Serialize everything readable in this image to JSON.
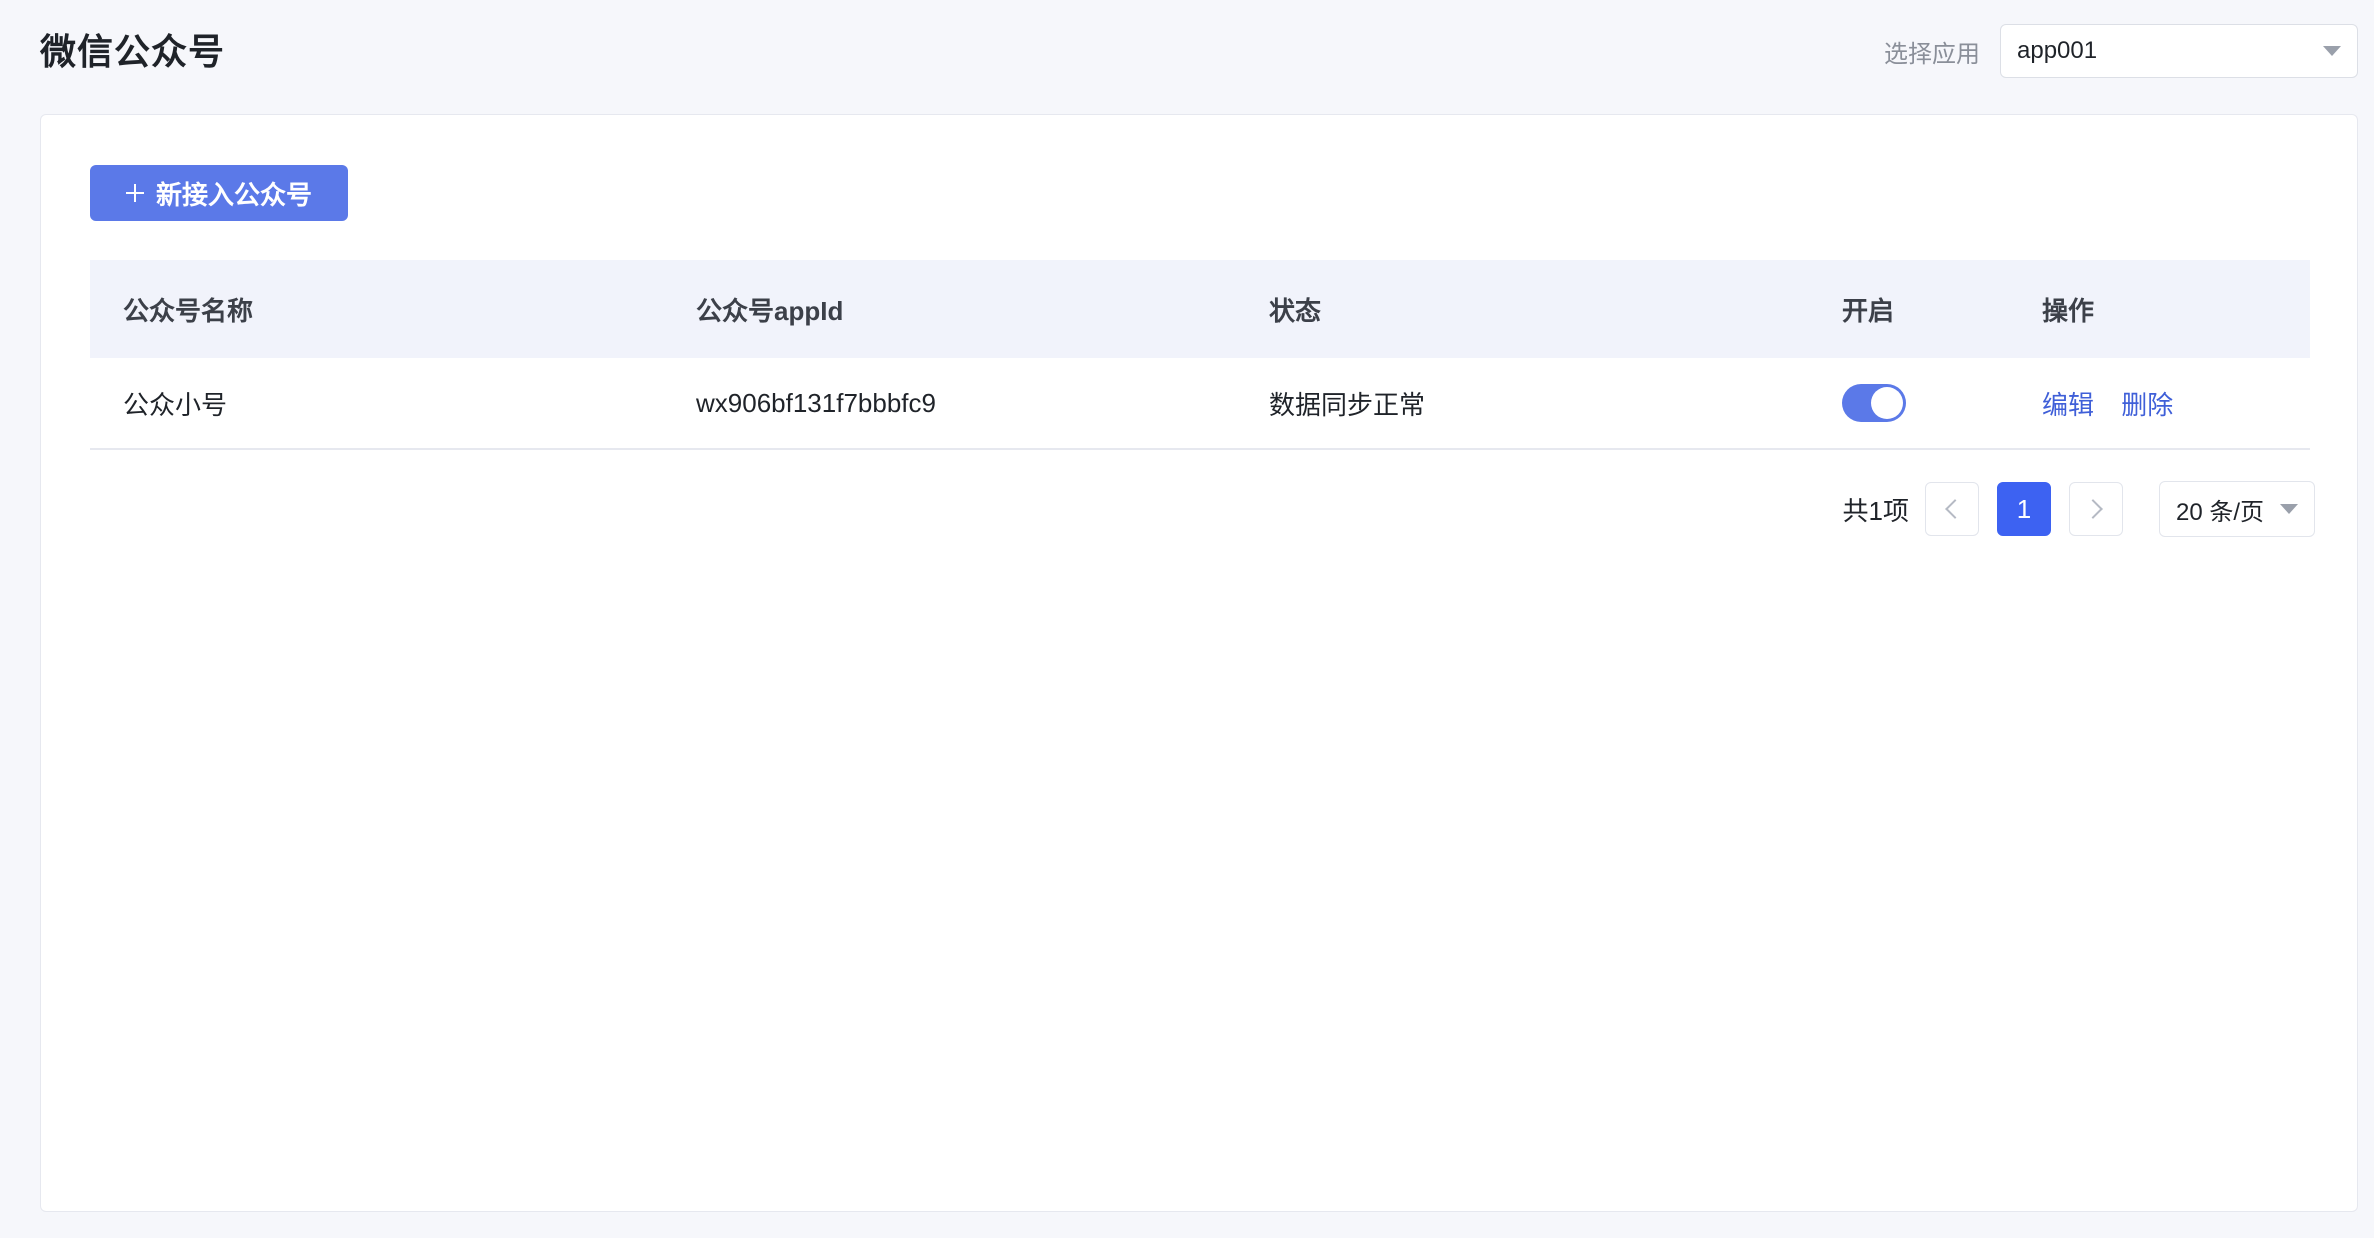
{
  "header": {
    "title": "微信公众号",
    "app_select_label": "选择应用",
    "app_select_value": "app001"
  },
  "toolbar": {
    "add_label": "新接入公众号"
  },
  "table": {
    "columns": [
      "公众号名称",
      "公众号appId",
      "状态",
      "开启",
      "操作"
    ],
    "rows": [
      {
        "name": "公众小号",
        "appid": "wx906bf131f7bbbfc9",
        "status": "数据同步正常",
        "enabled": true,
        "actions": [
          "编辑",
          "删除"
        ]
      }
    ]
  },
  "pagination": {
    "total_text": "共1项",
    "current_page": "1",
    "page_size": "20 条/页"
  },
  "colors": {
    "primary": "#5b79e8",
    "link": "#3f5fd8",
    "active_page": "#3d62f2"
  },
  "icons": [
    "plus-icon",
    "chevron-down-icon",
    "chevron-left-icon",
    "chevron-right-icon"
  ]
}
